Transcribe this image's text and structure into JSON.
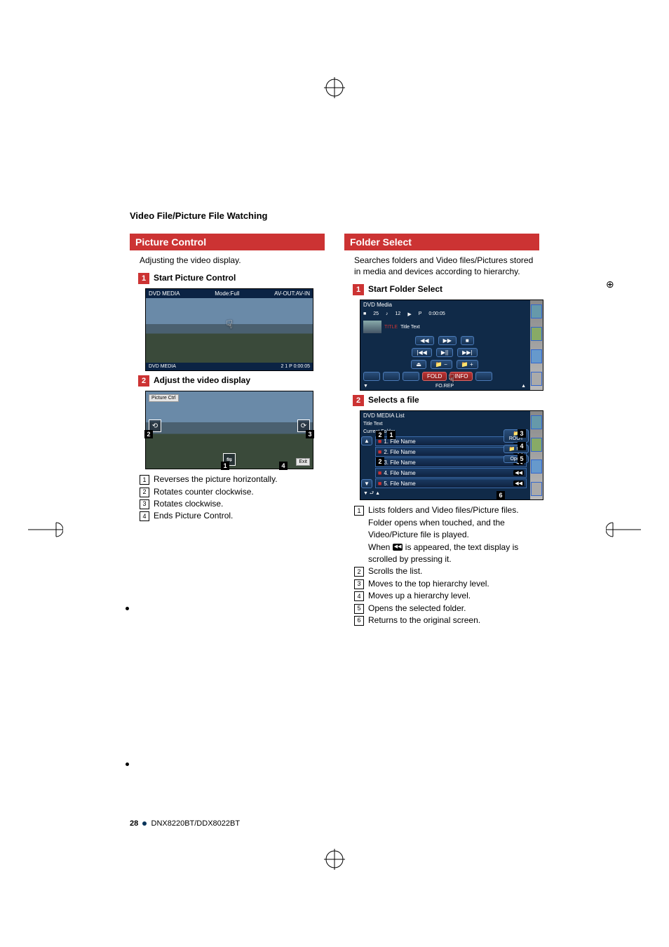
{
  "breadcrumb": "Video File/Picture File Watching",
  "left": {
    "header": "Picture Control",
    "intro": "Adjusting the video display.",
    "step1": {
      "num": "1",
      "label": "Start Picture Control"
    },
    "ss1": {
      "title_left": "DVD MEDIA",
      "title_mid": "Mode:Full",
      "title_right": "AV-OUT:AV-IN",
      "bottom_left": "DVD MEDIA",
      "bottom_vals": "2      1             P     0:00:05"
    },
    "step2": {
      "num": "2",
      "label": "Adjust the video display"
    },
    "ss2": {
      "ctrl_label": "Picture Ctrl",
      "exit": "Exit"
    },
    "legend": [
      {
        "n": "1",
        "t": "Reverses the picture horizontally."
      },
      {
        "n": "2",
        "t": "Rotates counter clockwise."
      },
      {
        "n": "3",
        "t": "Rotates clockwise."
      },
      {
        "n": "4",
        "t": "Ends Picture Control."
      }
    ]
  },
  "right": {
    "header": "Folder Select",
    "intro": "Searches folders and Video files/Pictures stored in media and devices according to hierarchy.",
    "step1": {
      "num": "1",
      "label": "Start Folder Select"
    },
    "ss1": {
      "title": "DVD Media",
      "top": {
        "a": "25",
        "b": "12",
        "c": "P",
        "d": "0:00:05"
      },
      "title_text": "Title Text",
      "fold": "FOLD",
      "info": "INFO",
      "rep": "FO.REP"
    },
    "step2": {
      "num": "2",
      "label": "Selects a file"
    },
    "ss2": {
      "title": "DVD MEDIA List",
      "sub1": "Title Text",
      "sub2": "Current Folder",
      "files": [
        "1. File Name",
        "2. File Name",
        "3. File Name",
        "4. File Name",
        "5. File Name"
      ],
      "root": "ROOT",
      "up": "UP",
      "open": "Open"
    },
    "legend": [
      {
        "n": "1",
        "t": "Lists folders and Video files/Picture files. Folder opens when touched, and the Video/Picture file is played.",
        "extra": "When  is appeared, the text display is scrolled by pressing it."
      },
      {
        "n": "2",
        "t": "Scrolls the list."
      },
      {
        "n": "3",
        "t": "Moves to the top hierarchy level."
      },
      {
        "n": "4",
        "t": "Moves up a hierarchy level."
      },
      {
        "n": "5",
        "t": "Opens the selected folder."
      },
      {
        "n": "6",
        "t": "Returns to the original screen."
      }
    ]
  },
  "footer": {
    "page": "28",
    "model": "DNX8220BT/DDX8022BT"
  }
}
